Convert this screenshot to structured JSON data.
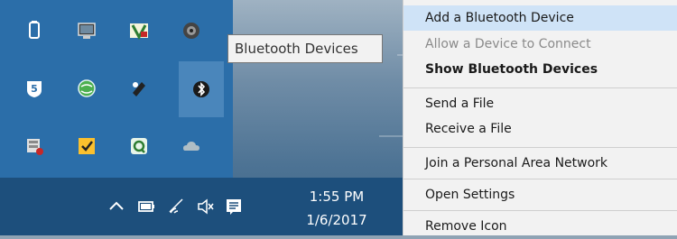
{
  "tray": {
    "icons": [
      {
        "name": "usb-drive-icon"
      },
      {
        "name": "display-icon"
      },
      {
        "name": "app-v-icon"
      },
      {
        "name": "webcam-icon"
      },
      {
        "name": "shield-5-icon"
      },
      {
        "name": "network-globe-icon"
      },
      {
        "name": "satellite-icon"
      },
      {
        "name": "bluetooth-icon"
      },
      {
        "name": "database-icon"
      },
      {
        "name": "norton-icon"
      },
      {
        "name": "sync-icon"
      },
      {
        "name": "onedrive-icon"
      }
    ],
    "tooltip": "Bluetooth Devices"
  },
  "taskbar": {
    "time": "1:55 PM",
    "date": "1/6/2017"
  },
  "context_menu": {
    "items": [
      {
        "label": "Add a Bluetooth Device"
      },
      {
        "label": "Allow a Device to Connect"
      },
      {
        "label": "Show Bluetooth Devices"
      },
      {
        "label": "Send a File"
      },
      {
        "label": "Receive a File"
      },
      {
        "label": "Join a Personal Area Network"
      },
      {
        "label": "Open Settings"
      },
      {
        "label": "Remove Icon"
      }
    ]
  },
  "colors": {
    "flyout": "#2b6ea9",
    "taskbar": "#1d4f7c",
    "menu_bg": "#f2f2f2",
    "menu_highlight": "#cfe3f7"
  }
}
